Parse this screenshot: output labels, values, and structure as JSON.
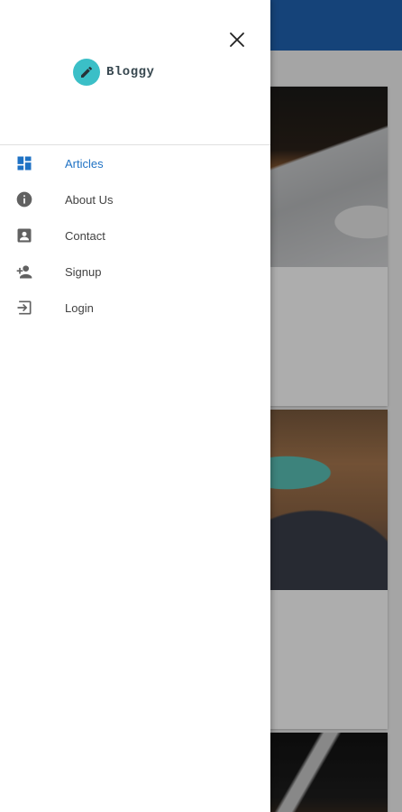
{
  "brand": {
    "name": "Bloggy",
    "logo_icon": "pencil-icon",
    "logo_color": "#3bbfc7"
  },
  "drawer": {
    "close_icon": "close-icon",
    "nav": [
      {
        "label": "Articles",
        "icon": "dashboard-icon",
        "active": true
      },
      {
        "label": "About Us",
        "icon": "info-icon",
        "active": false
      },
      {
        "label": "Contact",
        "icon": "contact-card-icon",
        "active": false
      },
      {
        "label": "Signup",
        "icon": "person-add-icon",
        "active": false
      },
      {
        "label": "Login",
        "icon": "login-icon",
        "active": false
      }
    ]
  },
  "colors": {
    "app_bar": "#1f64b3",
    "active_nav": "#1f72c4",
    "nav_text": "#424242",
    "icon_gray": "#616161"
  }
}
